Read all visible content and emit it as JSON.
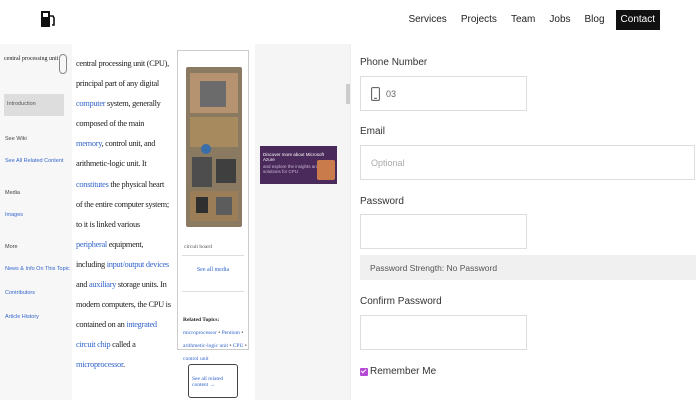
{
  "nav": {
    "links": [
      "Services",
      "Projects",
      "Team",
      "Jobs",
      "Blog"
    ],
    "contact_label": "Contact"
  },
  "embed": {
    "search_value": "central processing unit",
    "sidebar_active": "Introduction",
    "sidebar_heads": [
      "See Wiki",
      "Media",
      "More"
    ],
    "sidebar_items": [
      "See All Related Content",
      "Images",
      "News & Info On This Topic",
      "Contributors",
      "Article History"
    ],
    "article_runs": [
      {
        "t": "central processing unit (CPU), principal part of any digital ",
        "link": false
      },
      {
        "t": "computer",
        "link": true
      },
      {
        "t": " system, generally composed of the main ",
        "link": false
      },
      {
        "t": "memory",
        "link": true
      },
      {
        "t": ", control unit, and arithmetic-logic unit. It ",
        "link": false
      },
      {
        "t": "constitutes",
        "link": true
      },
      {
        "t": " the physical heart of the entire computer system; to it is linked various ",
        "link": false
      },
      {
        "t": "peripheral",
        "link": true
      },
      {
        "t": " equipment, including ",
        "link": false
      },
      {
        "t": "input/output devices",
        "link": true
      },
      {
        "t": " and ",
        "link": false
      },
      {
        "t": "auxiliary",
        "link": true
      },
      {
        "t": " storage units. In modern computers, the CPU is contained on an ",
        "link": false
      },
      {
        "t": "integrated circuit chip",
        "link": true
      },
      {
        "t": " called a ",
        "link": false
      },
      {
        "t": "microprocessor",
        "link": true
      },
      {
        "t": ".",
        "link": false
      }
    ],
    "image_caption": "circuit board",
    "see_all_media": "See all media",
    "related_label": "Related Topics:",
    "related_topics": [
      "microprocessor",
      "Pentium",
      "arithmetic-logic unit",
      "CPU",
      "control unit"
    ],
    "see_all_related": "See all related content →",
    "ad_line1": "Discover more about Microsoft Azure",
    "ad_line2": "and explore the insights and solutions for CPU"
  },
  "form": {
    "phone_label": "Phone Number",
    "phone_value": "03",
    "email_label": "Email",
    "email_placeholder": "Optional",
    "password_label": "Password",
    "password_strength": "Password Strength: No Password",
    "confirm_label": "Confirm Password",
    "remember_label": "Remember Me",
    "remember_checked": true
  },
  "colors": {
    "accent": "#b44ad6",
    "nav_contact_bg": "#111111",
    "link": "#3366cc"
  }
}
